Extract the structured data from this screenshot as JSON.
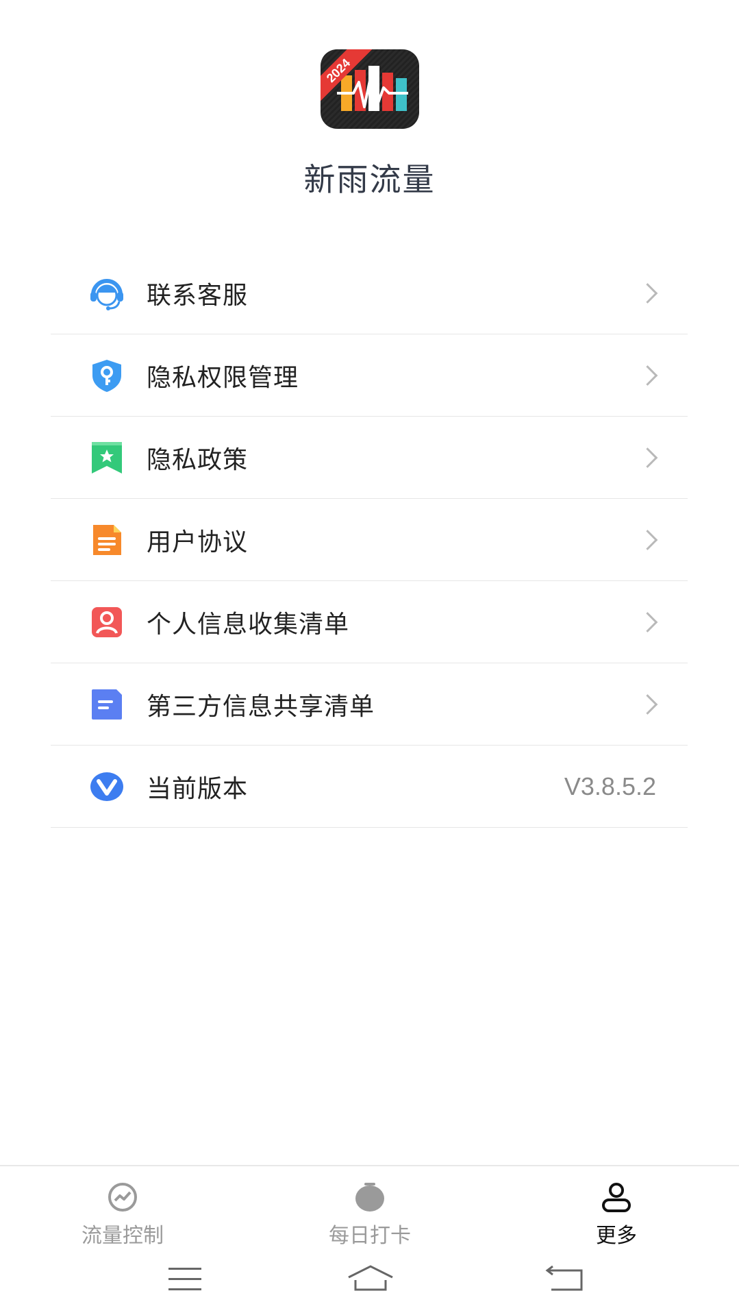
{
  "app": {
    "title": "新雨流量",
    "logo_badge": "2024"
  },
  "menu": [
    {
      "label": "联系客服",
      "icon": "customer-service-icon",
      "color": "#3b95f0"
    },
    {
      "label": "隐私权限管理",
      "icon": "shield-key-icon",
      "color": "#3d9cf2"
    },
    {
      "label": "隐私政策",
      "icon": "bookmark-star-icon",
      "color": "#33c97a"
    },
    {
      "label": "用户协议",
      "icon": "document-icon",
      "color": "#f7892b"
    },
    {
      "label": "个人信息收集清单",
      "icon": "user-card-icon",
      "color": "#f25757"
    },
    {
      "label": "第三方信息共享清单",
      "icon": "note-icon",
      "color": "#5b7ff2"
    },
    {
      "label": "当前版本",
      "icon": "v-logo-icon",
      "color": "#3d7df0",
      "value": "V3.8.5.2"
    }
  ],
  "bottom_nav": [
    {
      "label": "流量控制",
      "icon": "traffic-gauge-icon",
      "active": false
    },
    {
      "label": "每日打卡",
      "icon": "checkin-icon",
      "active": false
    },
    {
      "label": "更多",
      "icon": "user-icon",
      "active": true
    }
  ],
  "system_nav": [
    "menu-lines-icon",
    "home-icon",
    "back-icon"
  ]
}
